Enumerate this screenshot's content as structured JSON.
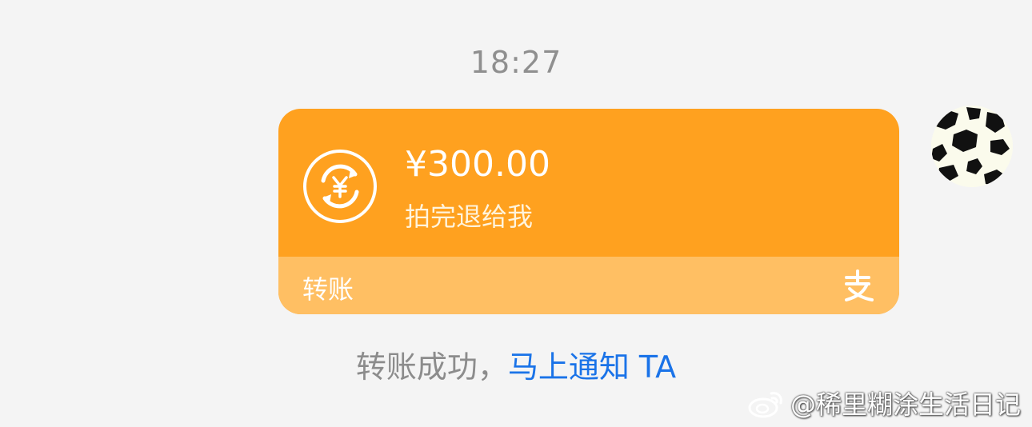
{
  "prev_message": {
    "text": "",
    "link": ""
  },
  "time": "18:27",
  "transfer": {
    "amount": "¥300.00",
    "memo": "拍完退给我",
    "type_label": "转账",
    "coin_icon": "yuan-exchange-icon",
    "provider_icon": "alipay-icon"
  },
  "avatar": {
    "icon": "cow-pattern-avatar"
  },
  "status": {
    "text": "转账成功，",
    "link": "马上通知 TA"
  },
  "watermark": {
    "text": "@稀里糊涂生活日记",
    "icon": "weibo-icon"
  },
  "colors": {
    "card": "#ffa11f",
    "card_footer": "#ffbf63",
    "link": "#1a73e8",
    "background": "#f4f4f4"
  }
}
